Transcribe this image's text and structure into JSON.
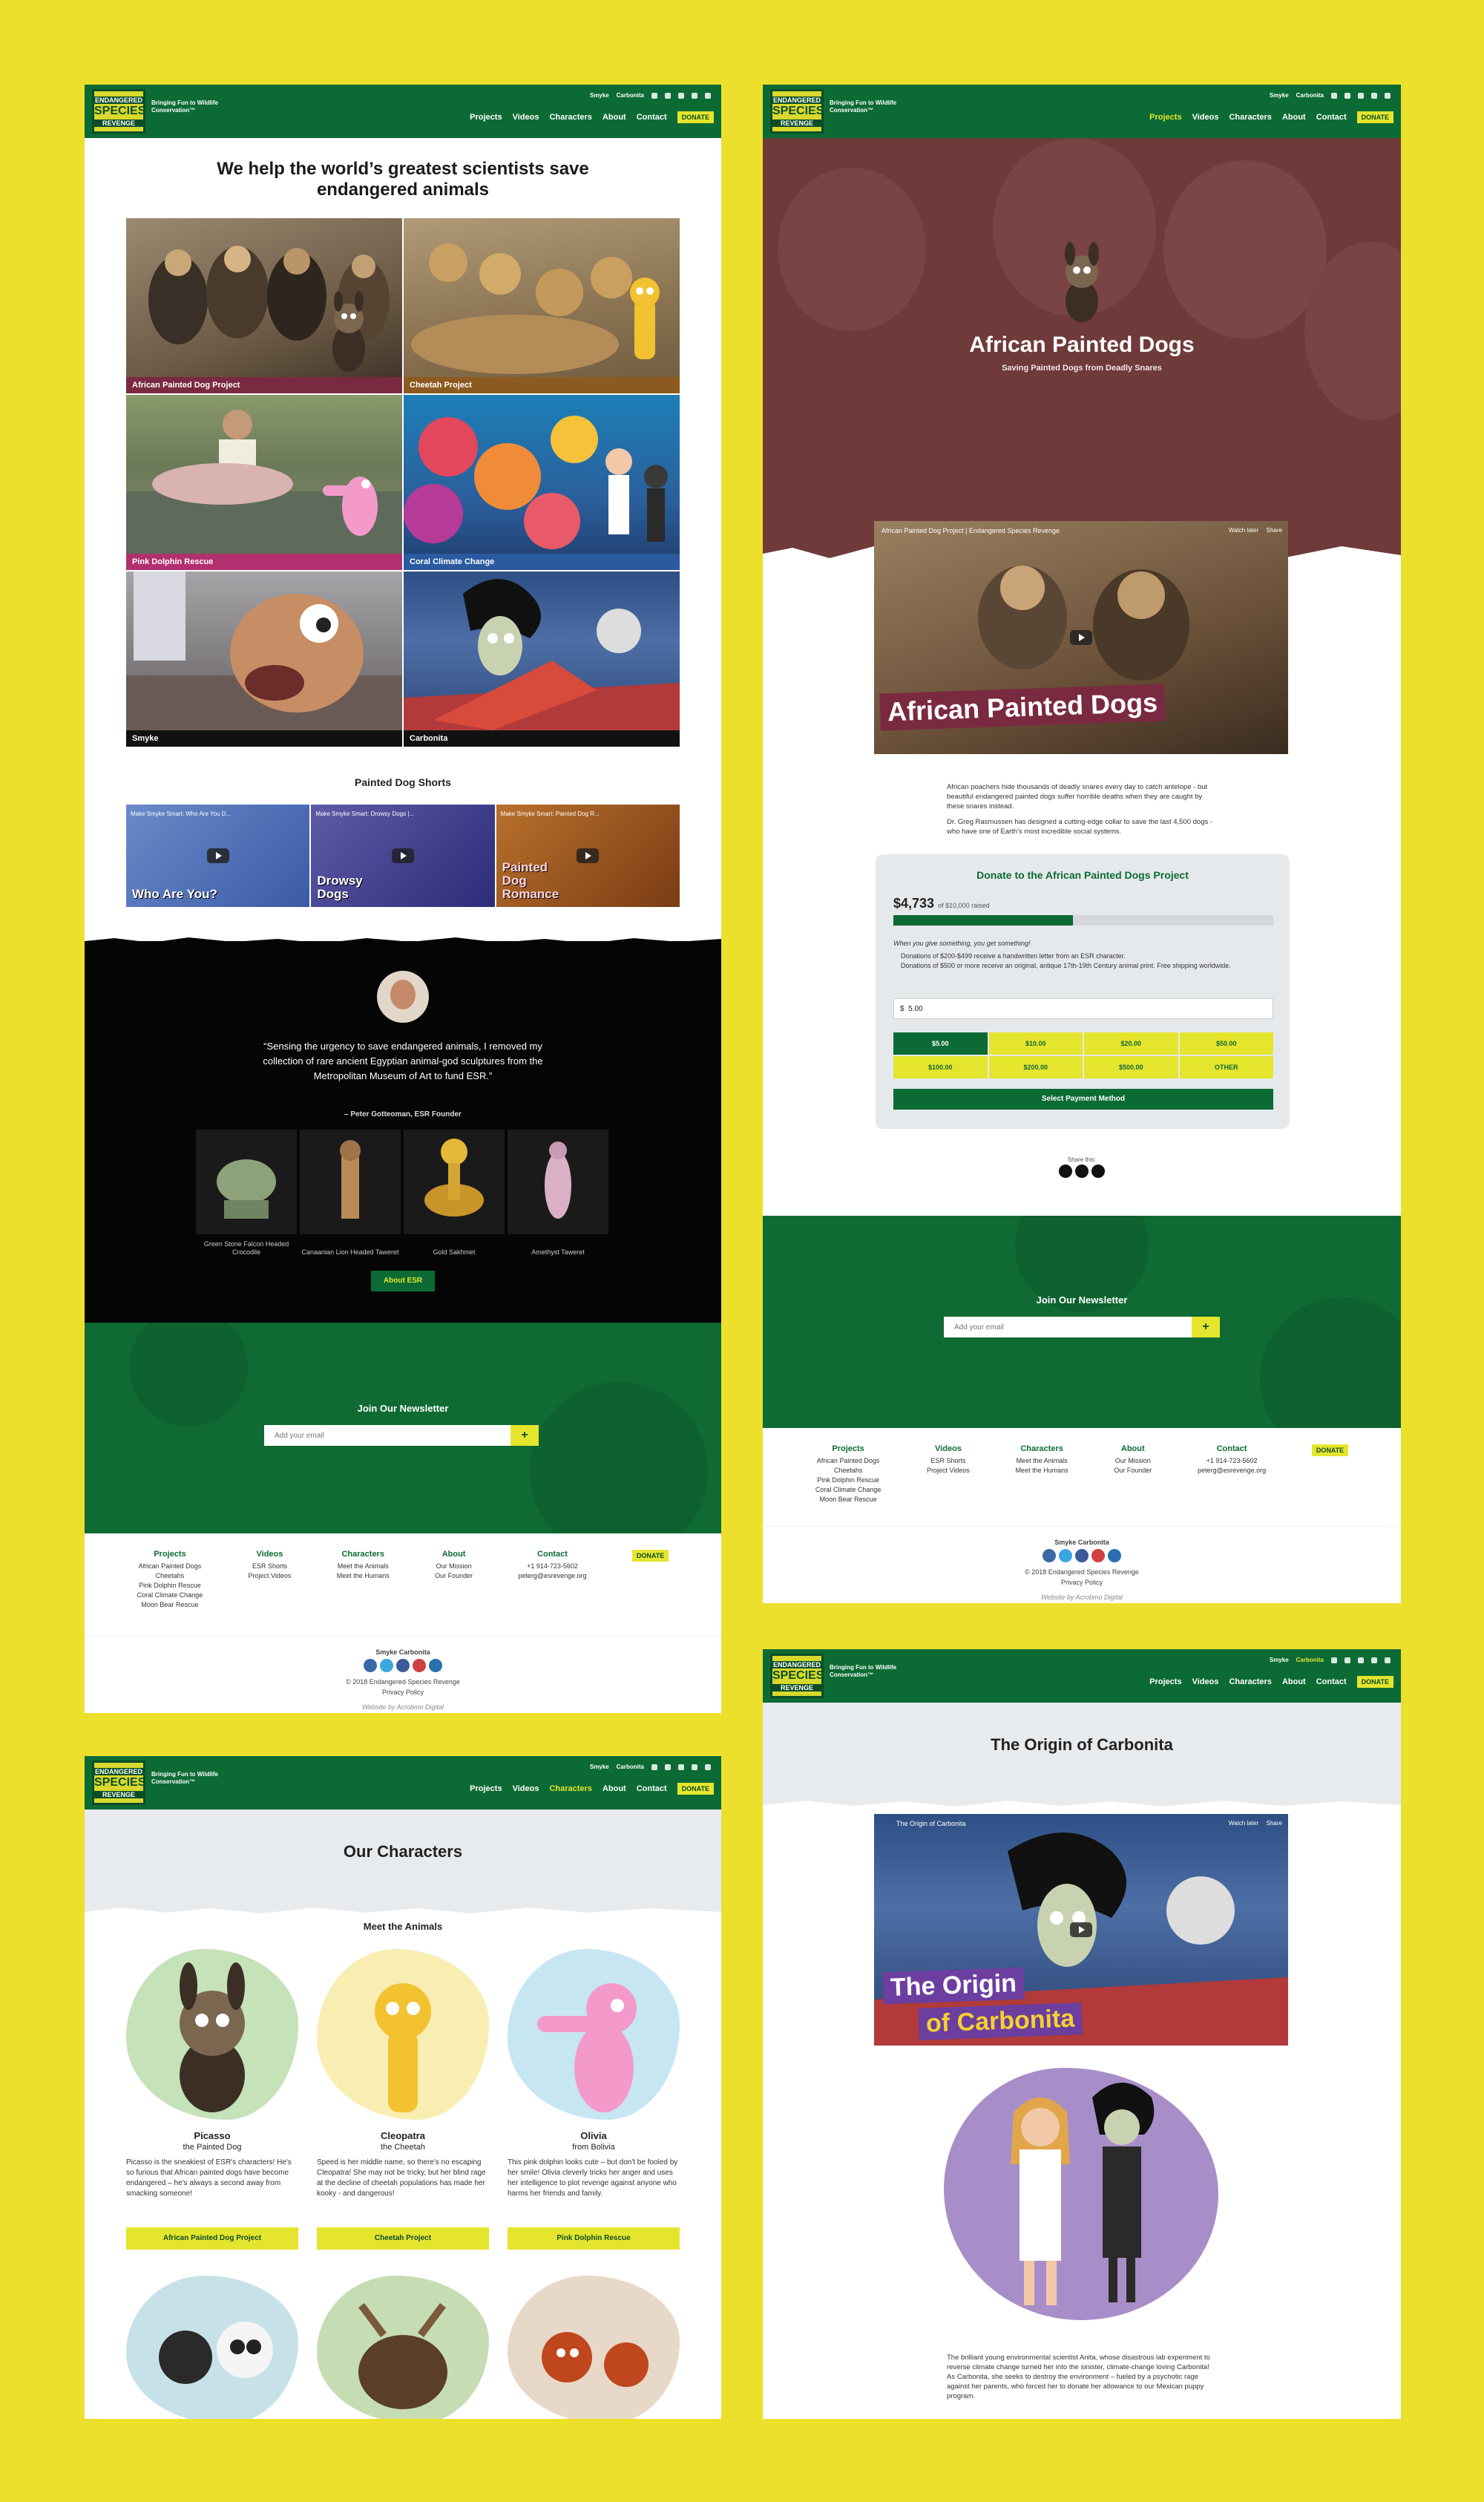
{
  "header": {
    "logo_line1": "ENDANGERED",
    "logo_line2": "SPECIES",
    "logo_line3": "REVENGE",
    "tagline": "Bringing Fun to Wildlife Conservation™",
    "top_links": [
      "Smyke",
      "Carbonita"
    ],
    "nav": [
      "Projects",
      "Videos",
      "Characters",
      "About",
      "Contact"
    ],
    "donate": "DONATE"
  },
  "colors": {
    "brand_green": "#0c6b34",
    "accent_yellow": "#e5e52d",
    "background": "#ece02c",
    "hero_maroon": "#6f3a3a"
  },
  "home": {
    "headline": "We help the world’s greatest scientists save endangered animals",
    "tiles": [
      "African Painted Dog Project",
      "Cheetah Project",
      "Pink Dolphin Rescue",
      "Coral Climate Change",
      "Smyke",
      "Carbonita"
    ],
    "shorts_title": "Painted Dog Shorts",
    "shorts": [
      {
        "video_title": "Make Smyke Smart: Who Are You D...",
        "overlay": "Who Are You?"
      },
      {
        "video_title": "Make Smyke Smart: Drowsy Dogs |...",
        "overlay": "Drowsy Dogs"
      },
      {
        "video_title": "Make Smyke Smart: Painted Dog R...",
        "overlay": "Painted Dog Romance"
      }
    ],
    "quote": "“Sensing the urgency to save endangered animals, I removed my collection of rare ancient Egyptian animal-god sculptures from the Metropolitan Museum of Art to fund ESR.”",
    "quote_author": "– Peter Gotteoman, ESR Founder",
    "statues": [
      "Green Stone Falcon Headed Crocodile",
      "Canaanian Lion Headed Taweret",
      "Gold Sakhmet",
      "Amethyst Taweret"
    ],
    "about_button": "About ESR"
  },
  "newsletter": {
    "title": "Join Our Newsletter",
    "placeholder": "Add your email",
    "submit": "+"
  },
  "footer": {
    "columns": [
      {
        "title": "Projects",
        "items": [
          "African Painted Dogs",
          "Cheetahs",
          "Pink Dolphin Rescue",
          "Coral Climate Change",
          "Moon Bear Rescue"
        ]
      },
      {
        "title": "Videos",
        "items": [
          "ESR Shorts",
          "Project Videos"
        ]
      },
      {
        "title": "Characters",
        "items": [
          "Meet the Animals",
          "Meet the Humans"
        ]
      },
      {
        "title": "About",
        "items": [
          "Our Mission",
          "Our Founder"
        ]
      },
      {
        "title": "Contact",
        "items": [
          "+1 914-723-5602",
          "peterg@esrevenge.org"
        ]
      }
    ],
    "links": "Smyke   Carbonita",
    "copyright": "© 2018 Endangered Species Revenge",
    "privacy": "Privacy Policy",
    "credit": "Website by Acrobmo Digital"
  },
  "project": {
    "title": "African Painted Dogs",
    "subtitle": "Saving Painted Dogs from Deadly Snares",
    "video_title": "African Painted Dog Project | Endangered Species Revenge",
    "watch_later": "Watch later",
    "share": "Share",
    "video_overlay": "African Painted Dogs",
    "para1": "African poachers hide thousands of deadly snares every day to catch antelope - but beautiful endangered painted dogs suffer horrible deaths when they are caught by these snares instead.",
    "para2": "Dr. Greg Rasmussen has designed a cutting-edge collar to save the last 4,500 dogs - who have one of Earth's most incredible social systems.",
    "donate_title": "Donate to the African Painted Dogs Project",
    "raised": "$4,733",
    "goal_text": "of $10,000 raised",
    "progress": 0.4733,
    "gift_intro": "When you give something, you get something!",
    "gift_1": "Donations of $200-$499 receive a handwritten letter from an ESR character.",
    "gift_2": "Donations of $500 or more receive an original, antique 17th-19th Century animal print. Free shipping worldwide.",
    "amount_symbol": "$",
    "amount_value": "5.00",
    "amounts": [
      "$5.00",
      "$10.00",
      "$20.00",
      "$50.00",
      "$100.00",
      "$200.00",
      "$500.00",
      "OTHER"
    ],
    "payment_button": "Select Payment Method",
    "share_label": "Share this:"
  },
  "characters": {
    "title": "Our Characters",
    "section": "Meet the Animals",
    "cards": [
      {
        "name": "Picasso",
        "sub": "the Painted Dog",
        "desc": "Picasso is the sneakiest of ESR's characters! He's so furious that African painted dogs have become endangered – he's always a second away from smacking someone!",
        "button": "African Painted Dog Project"
      },
      {
        "name": "Cleopatra",
        "sub": "the Cheetah",
        "desc": "Speed is her middle name, so there's no escaping Cleopatra! She may not be tricky, but her blind rage at the decline of cheetah populations has made her kooky - and dangerous!",
        "button": "Cheetah Project"
      },
      {
        "name": "Olivia",
        "sub": "from Bolivia",
        "desc": "This pink dolphin looks cute – but don't be fooled by her smile! Olivia cleverly tricks her anger and uses her intelligence to plot revenge against anyone who harms her friends and family.",
        "button": "Pink Dolphin Rescue"
      }
    ]
  },
  "carbonita": {
    "title": "The Origin of Carbonita",
    "video_title": "The Origin of Carbonita",
    "overlay_1": "The Origin",
    "overlay_2": "of Carbonita",
    "para": "The brilliant young environmental scientist Anita, whose disastrous lab experiment to reverse climate change turned her into the sinister, climate-change loving Carbonita! As Carbonita, she seeks to destroy the environment – fueled by a psychotic rage against her parents, who forced her to donate her allowance to our Mexican puppy program."
  }
}
